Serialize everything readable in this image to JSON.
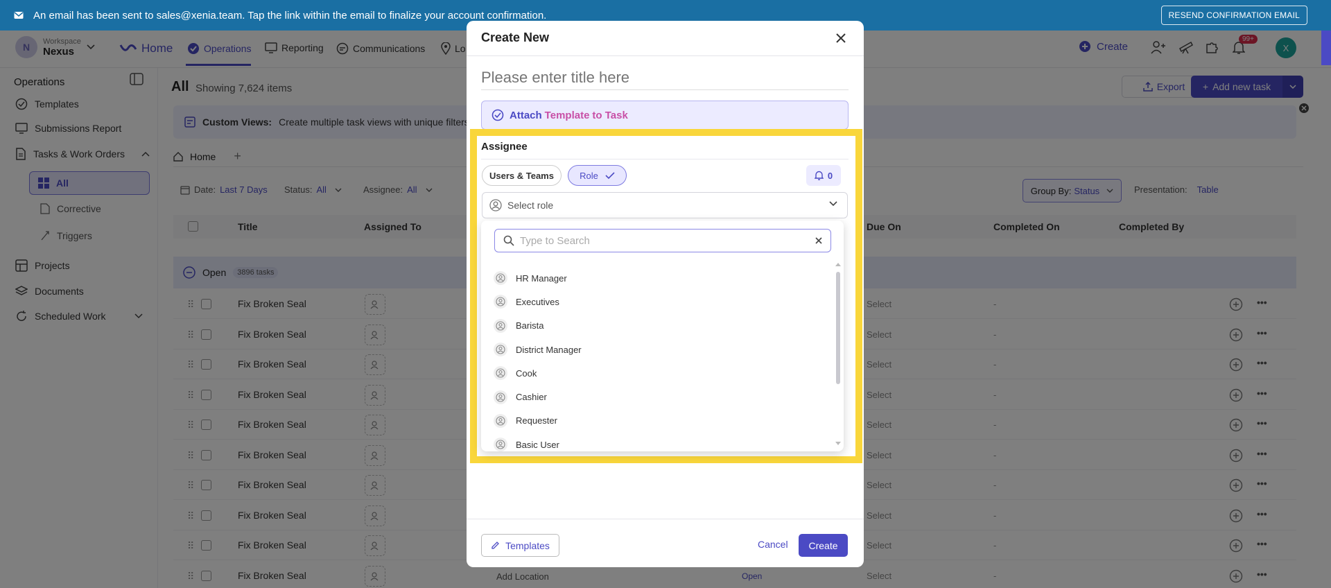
{
  "banner": {
    "message": "An email has been sent to sales@xenia.team. Tap the link within the email to finalize your account confirmation.",
    "resend_label": "RESEND CONFIRMATION EMAIL"
  },
  "workspace": {
    "avatar_letter": "N",
    "label": "Workspace",
    "name": "Nexus"
  },
  "topnav": {
    "home": "Home",
    "items": [
      "Operations",
      "Reporting",
      "Communications",
      "Lo"
    ],
    "create": "Create",
    "notification_badge": "99+",
    "user_initial": "X"
  },
  "sidebar": {
    "title": "Operations",
    "items": [
      "Templates",
      "Submissions Report",
      "Tasks & Work Orders",
      "Projects",
      "Documents",
      "Scheduled Work"
    ],
    "sub_items": [
      "All",
      "Corrective",
      "Triggers"
    ]
  },
  "main": {
    "title": "All",
    "count": "Showing 7,624 items",
    "export": "Export",
    "add_new": "Add new task",
    "custom_views_bold": "Custom Views:",
    "custom_views_text": "Create multiple task views with unique filters. T",
    "tab_home": "Home",
    "filters": {
      "date_label": "Date:",
      "date_value": "Last 7 Days",
      "status_label": "Status:",
      "status_value": "All",
      "assignee_label": "Assignee:",
      "assignee_value": "All"
    },
    "group_by_label": "Group By:",
    "group_by_value": "Status",
    "presentation_label": "Presentation:",
    "presentation_value": "Table",
    "columns": [
      "Title",
      "Assigned To",
      "Due On",
      "Completed On",
      "Completed By"
    ],
    "group": {
      "label": "Open",
      "count": "3896 tasks"
    },
    "row_title": "Fix Broken Seal",
    "row_select": "Select",
    "row_dash": "-",
    "add_location": "Add Location",
    "open_label": "Open"
  },
  "modal": {
    "title": "Create New",
    "title_placeholder": "Please enter title here",
    "attach_a": "Attach",
    "attach_b": "Template",
    "attach_c": "to Task",
    "assignee_label": "Assignee",
    "chip_users": "Users & Teams",
    "chip_role": "Role",
    "notify_count": "0",
    "select_role": "Select role",
    "search_placeholder": "Type to Search",
    "roles": [
      "HR Manager",
      "Executives",
      "Barista",
      "District Manager",
      "Cook",
      "Cashier",
      "Requester",
      "Basic User"
    ],
    "templates_btn": "Templates",
    "cancel": "Cancel",
    "create": "Create"
  },
  "colors": {
    "accent": "#4b4ac4",
    "banner": "#1a6fa3",
    "highlight": "#f9d63b"
  }
}
